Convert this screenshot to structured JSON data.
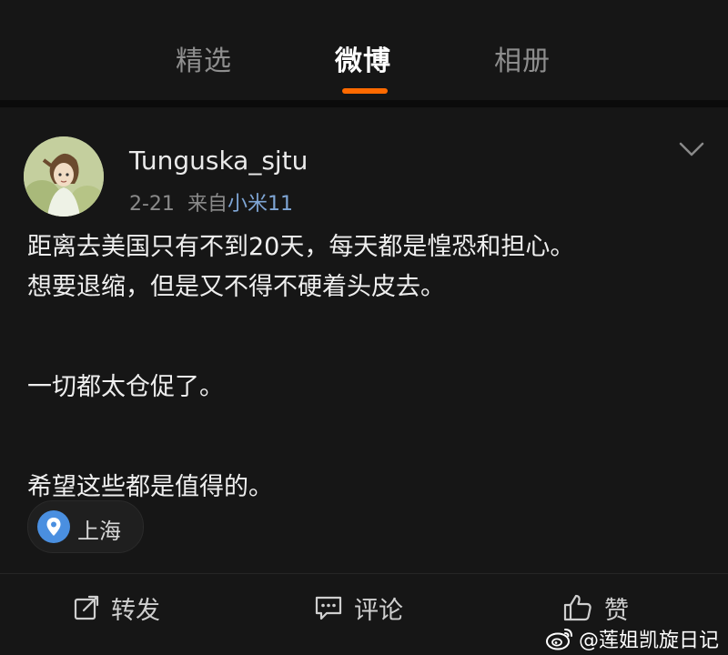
{
  "tabs": [
    {
      "label": "精选",
      "active": false
    },
    {
      "label": "微博",
      "active": true
    },
    {
      "label": "相册",
      "active": false
    }
  ],
  "accent_color": "#ff6a00",
  "post": {
    "username": "Tunguska_sjtu",
    "date": "2-21",
    "source_prefix": "来自",
    "device": "小米11",
    "paragraphs": [
      "距离去美国只有不到20天，每天都是惶恐和担心。",
      "想要退缩，但是又不得不硬着头皮去。",
      "一切都太仓促了。",
      "希望这些都是值得的。"
    ],
    "location": "上海"
  },
  "actions": {
    "repost": "转发",
    "comment": "评论",
    "like": "赞"
  },
  "watermark": "@莲姐凯旋日记"
}
